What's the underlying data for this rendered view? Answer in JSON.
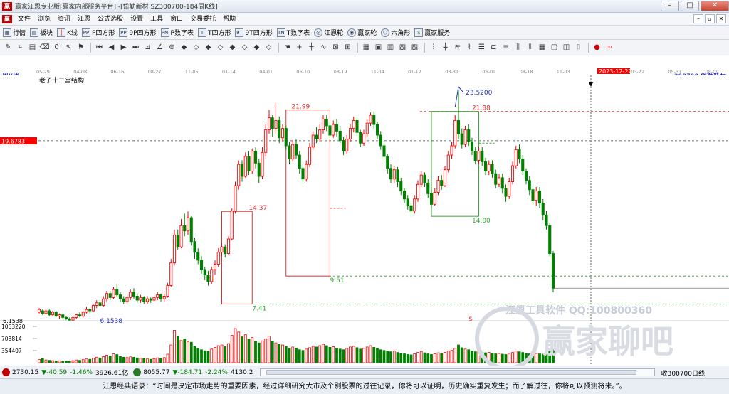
{
  "window": {
    "title": "赢家江恩专业版[赢家内部服务平台] -[岱勒新材  SZ300700-184周K线]",
    "logo": "赢"
  },
  "menu": [
    "文件",
    "浏览",
    "资讯",
    "江恩",
    "公式选股",
    "设置",
    "工具",
    "窗口",
    "交易委托",
    "帮助"
  ],
  "toolbar": [
    "行情",
    "板块",
    "K线",
    "P四方形",
    "9P四方形",
    "P数字表",
    "T四方形",
    "9T四方形",
    "T数字表",
    "江恩轮",
    "赢家轮",
    "六角形",
    "赢家服务"
  ],
  "toolbar_icons": [
    "PP",
    "P",
    "9P",
    "PN",
    "T",
    "9T",
    "TN"
  ],
  "date_axis": {
    "highlight": "2023-12-22",
    "ticks": [
      "05-29",
      "04-08",
      "06-16",
      "08-27",
      "11-05",
      "01-14",
      "04-01",
      "06-10",
      "08-19",
      "11-04",
      "01-12",
      "03-31",
      "06-09",
      "08-18",
      "11-03",
      "2023-12-22",
      "03-22",
      "05-31",
      "08-09"
    ]
  },
  "chart": {
    "period_label": "周K线",
    "indicator_name": "老子十二宫结构",
    "stock_label": "300700  岱勒新材",
    "price_marker": "19.6783",
    "low_price": "6.1538",
    "annotations": [
      "21.99",
      "21.88",
      "23.5200",
      "14.37",
      "14.00",
      "9.51",
      "7.41",
      "6.1538"
    ],
    "dollar_mark": "$",
    "volume_ticks": [
      "1063220",
      "708814",
      "354407"
    ],
    "watermark_main": "赢家聊吧",
    "watermark_sub": "江恩工具软件  QQ:100800360",
    "watermark_url": "liaoba.ying36",
    "weekly_bars": [
      [
        6.8,
        7.0,
        6.7,
        7.1
      ],
      [
        6.9,
        6.7,
        6.6,
        7.0
      ],
      [
        6.7,
        6.9,
        6.6,
        7.0
      ],
      [
        6.9,
        6.6,
        6.5,
        7.0
      ],
      [
        6.6,
        6.8,
        6.5,
        6.9
      ],
      [
        6.8,
        6.5,
        6.4,
        6.9
      ],
      [
        6.5,
        6.6,
        6.3,
        6.7
      ],
      [
        6.6,
        6.4,
        6.3,
        6.7
      ],
      [
        6.4,
        6.3,
        6.2,
        6.5
      ],
      [
        6.3,
        6.2,
        6.15,
        6.4
      ],
      [
        6.2,
        6.4,
        6.15,
        6.5
      ],
      [
        6.4,
        6.6,
        6.3,
        6.7
      ],
      [
        6.6,
        6.5,
        6.4,
        6.8
      ],
      [
        6.5,
        6.8,
        6.4,
        6.9
      ],
      [
        6.8,
        7.0,
        6.7,
        7.2
      ],
      [
        7.0,
        6.9,
        6.7,
        7.1
      ],
      [
        6.9,
        7.3,
        6.8,
        7.4
      ],
      [
        7.3,
        7.5,
        7.1,
        7.7
      ],
      [
        7.5,
        7.3,
        7.2,
        7.8
      ],
      [
        7.3,
        7.8,
        7.2,
        8.0
      ],
      [
        7.8,
        8.2,
        7.6,
        8.4
      ],
      [
        8.2,
        7.9,
        7.7,
        8.4
      ],
      [
        7.9,
        8.5,
        7.8,
        8.7
      ],
      [
        8.5,
        8.1,
        7.9,
        8.9
      ],
      [
        8.1,
        7.8,
        7.6,
        8.3
      ],
      [
        7.8,
        7.6,
        7.4,
        8.0
      ],
      [
        7.6,
        7.9,
        7.4,
        8.1
      ],
      [
        7.9,
        8.3,
        7.7,
        8.5
      ],
      [
        8.3,
        8.0,
        7.8,
        8.6
      ],
      [
        8.0,
        7.7,
        7.5,
        8.2
      ],
      [
        7.7,
        7.9,
        7.5,
        8.1
      ],
      [
        7.9,
        7.6,
        7.4,
        8.0
      ],
      [
        7.6,
        7.8,
        7.4,
        8.0
      ],
      [
        7.8,
        7.7,
        7.5,
        7.9
      ],
      [
        7.7,
        7.9,
        7.6,
        8.0
      ],
      [
        7.9,
        8.1,
        7.7,
        8.3
      ],
      [
        8.1,
        7.8,
        7.6,
        8.2
      ],
      [
        7.8,
        8.0,
        7.6,
        8.2
      ],
      [
        8.0,
        8.8,
        7.9,
        9.0
      ],
      [
        8.8,
        10.5,
        8.7,
        10.8
      ],
      [
        10.5,
        12.6,
        10.3,
        13.0
      ],
      [
        12.6,
        11.7,
        11.5,
        13.0
      ],
      [
        11.7,
        13.3,
        11.6,
        13.8
      ],
      [
        13.3,
        12.9,
        12.5,
        14.2
      ],
      [
        12.9,
        13.9,
        12.6,
        14.37
      ],
      [
        13.9,
        12.1,
        11.8,
        14.0
      ],
      [
        12.1,
        11.3,
        10.8,
        12.4
      ],
      [
        11.3,
        10.7,
        10.4,
        11.6
      ],
      [
        10.7,
        10.0,
        9.7,
        11.0
      ],
      [
        10.0,
        9.6,
        9.2,
        10.2
      ],
      [
        9.6,
        9.1,
        8.8,
        9.9
      ],
      [
        9.1,
        10.0,
        8.9,
        10.2
      ],
      [
        10.0,
        10.4,
        9.6,
        10.7
      ],
      [
        10.4,
        11.3,
        10.2,
        11.6
      ],
      [
        11.3,
        11.7,
        11.0,
        12.0
      ],
      [
        11.7,
        11.2,
        10.9,
        11.9
      ],
      [
        11.2,
        12.3,
        11.1,
        12.5
      ],
      [
        12.3,
        14.4,
        12.2,
        14.6
      ],
      [
        14.4,
        16.3,
        14.2,
        16.6
      ],
      [
        16.3,
        17.9,
        16.0,
        18.2
      ],
      [
        17.9,
        17.0,
        16.6,
        18.2
      ],
      [
        17.0,
        18.5,
        16.9,
        18.8
      ],
      [
        18.5,
        17.4,
        17.1,
        18.9
      ],
      [
        17.4,
        18.9,
        17.2,
        19.1
      ],
      [
        18.9,
        18.0,
        17.6,
        19.2
      ],
      [
        18.0,
        17.0,
        16.5,
        18.3
      ],
      [
        17.0,
        18.8,
        16.8,
        19.2
      ],
      [
        18.8,
        20.5,
        18.5,
        20.9
      ],
      [
        20.5,
        21.4,
        20.2,
        21.99
      ],
      [
        21.4,
        20.6,
        20.0,
        21.6
      ],
      [
        20.6,
        21.2,
        20.2,
        22.5
      ],
      [
        21.2,
        19.9,
        19.5,
        21.5
      ],
      [
        19.9,
        20.6,
        19.6,
        20.9
      ],
      [
        20.6,
        19.3,
        19.0,
        20.8
      ],
      [
        19.3,
        18.3,
        17.9,
        19.6
      ],
      [
        18.3,
        19.4,
        18.1,
        19.7
      ],
      [
        19.4,
        18.6,
        18.3,
        19.8
      ],
      [
        18.6,
        17.6,
        17.2,
        18.9
      ],
      [
        17.6,
        16.8,
        16.4,
        17.9
      ],
      [
        16.8,
        17.9,
        16.6,
        18.2
      ],
      [
        17.9,
        19.2,
        17.7,
        19.5
      ],
      [
        19.2,
        20.1,
        19.0,
        20.4
      ],
      [
        20.1,
        19.8,
        19.5,
        20.7
      ],
      [
        19.8,
        20.5,
        19.6,
        20.9
      ],
      [
        20.5,
        21.3,
        20.2,
        21.6
      ],
      [
        21.3,
        20.8,
        20.4,
        21.6
      ],
      [
        20.8,
        20.1,
        19.8,
        21.1
      ],
      [
        20.1,
        20.9,
        19.9,
        21.2
      ],
      [
        20.9,
        20.4,
        20.0,
        21.3
      ],
      [
        20.4,
        19.7,
        19.5,
        20.8
      ],
      [
        19.7,
        18.9,
        18.6,
        20.0
      ],
      [
        18.9,
        19.8,
        18.7,
        20.1
      ],
      [
        19.8,
        20.6,
        19.6,
        20.9
      ],
      [
        20.6,
        21.2,
        20.3,
        21.5
      ],
      [
        21.2,
        20.3,
        20.0,
        21.5
      ],
      [
        20.3,
        19.5,
        19.2,
        20.5
      ],
      [
        19.5,
        20.2,
        19.3,
        20.5
      ],
      [
        20.2,
        21.0,
        20.0,
        21.3
      ],
      [
        21.0,
        21.6,
        20.8,
        21.8
      ],
      [
        21.6,
        20.9,
        20.6,
        21.88
      ],
      [
        20.9,
        20.1,
        19.8,
        21.1
      ],
      [
        20.1,
        19.3,
        19.0,
        20.4
      ],
      [
        19.3,
        18.5,
        18.1,
        19.5
      ],
      [
        18.5,
        17.6,
        17.2,
        18.7
      ],
      [
        17.6,
        16.8,
        16.5,
        17.9
      ],
      [
        16.8,
        17.5,
        16.5,
        17.8
      ],
      [
        17.5,
        16.6,
        16.2,
        17.7
      ],
      [
        16.6,
        15.9,
        15.6,
        16.9
      ],
      [
        15.9,
        15.3,
        15.0,
        16.1
      ],
      [
        15.3,
        14.8,
        14.5,
        15.6
      ],
      [
        14.8,
        14.4,
        14.0,
        15.0
      ],
      [
        14.4,
        15.3,
        14.2,
        15.6
      ],
      [
        15.3,
        16.4,
        15.1,
        16.7
      ],
      [
        16.4,
        17.1,
        16.2,
        17.4
      ],
      [
        17.1,
        16.5,
        16.2,
        17.3
      ],
      [
        16.5,
        15.7,
        15.4,
        16.8
      ],
      [
        15.7,
        14.9,
        14.6,
        16.0
      ],
      [
        14.9,
        15.8,
        14.8,
        16.1
      ],
      [
        15.8,
        16.7,
        15.6,
        17.0
      ],
      [
        16.7,
        16.3,
        16.0,
        17.1
      ],
      [
        16.3,
        17.5,
        16.2,
        17.8
      ],
      [
        17.5,
        18.6,
        17.3,
        18.9
      ],
      [
        18.6,
        19.3,
        18.3,
        19.6
      ],
      [
        19.3,
        21.2,
        19.1,
        21.6
      ],
      [
        21.2,
        20.2,
        19.8,
        23.52
      ],
      [
        20.2,
        19.4,
        19.1,
        20.6
      ],
      [
        19.4,
        20.5,
        19.2,
        20.8
      ],
      [
        20.5,
        19.6,
        19.3,
        20.9
      ],
      [
        19.6,
        18.9,
        18.6,
        19.9
      ],
      [
        18.9,
        18.2,
        17.9,
        19.2
      ],
      [
        18.2,
        18.9,
        17.9,
        19.2
      ],
      [
        18.9,
        18.1,
        17.8,
        19.2
      ],
      [
        18.1,
        17.4,
        17.1,
        18.4
      ],
      [
        17.4,
        17.9,
        17.1,
        18.2
      ],
      [
        17.9,
        17.2,
        16.9,
        18.2
      ],
      [
        17.2,
        16.4,
        16.1,
        17.5
      ],
      [
        16.4,
        16.9,
        16.2,
        17.2
      ],
      [
        16.9,
        16.1,
        15.7,
        17.2
      ],
      [
        16.1,
        15.5,
        15.1,
        16.4
      ],
      [
        15.5,
        16.6,
        15.3,
        16.9
      ],
      [
        16.6,
        17.8,
        16.4,
        18.1
      ],
      [
        17.8,
        19.0,
        17.6,
        19.3
      ],
      [
        19.0,
        18.3,
        18.0,
        19.4
      ],
      [
        18.3,
        17.4,
        17.1,
        18.6
      ],
      [
        17.4,
        16.7,
        16.4,
        17.6
      ],
      [
        16.7,
        16.0,
        15.6,
        17.0
      ],
      [
        16.0,
        15.2,
        14.9,
        16.3
      ],
      [
        15.2,
        15.9,
        14.8,
        16.2
      ],
      [
        15.9,
        15.0,
        14.6,
        16.2
      ],
      [
        15.0,
        14.1,
        13.7,
        15.3
      ],
      [
        14.1,
        13.3,
        13.0,
        14.4
      ],
      [
        13.3,
        11.2,
        11.0,
        13.5
      ],
      [
        11.2,
        8.6,
        8.3,
        11.4
      ]
    ],
    "volume": [
      95000,
      120000,
      80000,
      70000,
      60000,
      50000,
      55000,
      40000,
      45000,
      35000,
      60000,
      80000,
      70000,
      90000,
      110000,
      100000,
      130000,
      160000,
      140000,
      180000,
      220000,
      200000,
      260000,
      240000,
      180000,
      160000,
      150000,
      170000,
      160000,
      140000,
      130000,
      120000,
      110000,
      100000,
      120000,
      140000,
      130000,
      150000,
      250000,
      520000,
      950000,
      780000,
      650000,
      700000,
      620000,
      600000,
      480000,
      420000,
      380000,
      350000,
      330000,
      400000,
      450000,
      500000,
      520000,
      470000,
      560000,
      800000,
      1000000,
      900000,
      760000,
      820000,
      700000,
      740000,
      620000,
      580000,
      640000,
      700000,
      780000,
      620000,
      580000,
      540000,
      520000,
      480000,
      420000,
      460000,
      430000,
      380000,
      360000,
      400000,
      440000,
      480000,
      460000,
      500000,
      540000,
      500000,
      450000,
      470000,
      430000,
      400000,
      380000,
      420000,
      460000,
      480000,
      440000,
      400000,
      420000,
      460000,
      500000,
      450000,
      420000,
      380000,
      360000,
      340000,
      320000,
      340000,
      300000,
      280000,
      260000,
      240000,
      230000,
      260000,
      300000,
      320000,
      290000,
      260000,
      240000,
      260000,
      290000,
      270000,
      300000,
      340000,
      360000,
      420000,
      520000,
      440000,
      400000,
      380000,
      340000,
      320000,
      330000,
      310000,
      290000,
      300000,
      280000,
      260000,
      270000,
      250000,
      240000,
      270000,
      300000,
      340000,
      320000,
      300000,
      280000,
      260000,
      250000,
      270000,
      260000,
      250000,
      260000,
      330000,
      380000
    ]
  },
  "statusbar": {
    "sh_index": "2730.15",
    "sh_change": "▼-40.59",
    "sh_pct": "-1.46%",
    "sh_amount": "3926.61亿",
    "sz_index": "8055.77",
    "sz_change": "▼-184.71",
    "sz_pct": "-2.24%",
    "sz_amount": "4130.2",
    "right_label": "收300700日线"
  },
  "quote": "江恩经典语录：“时间是决定市场走势的重要因素，经过详细研究大市及个别股票的过往记录，你将可以证明，历史确实重复发生；而了解过往，你将可以预测将来。”。",
  "colors": {
    "up": "#ff0000",
    "down": "#008000",
    "box_red": "#e03030",
    "box_green": "#33aa33",
    "price_marker_bg": "#ff0000",
    "highlight_date_bg": "#ff0000"
  }
}
